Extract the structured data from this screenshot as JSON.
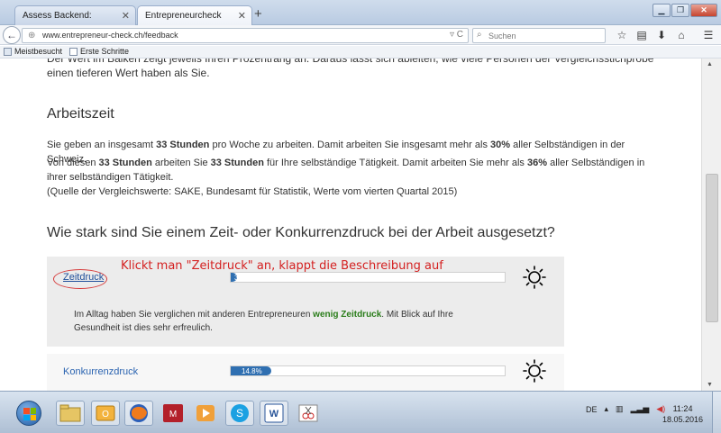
{
  "browser": {
    "tabs": [
      {
        "label": "Assess Backend:",
        "active": false
      },
      {
        "label": "Entrepreneurcheck",
        "active": true
      }
    ],
    "url": "www.entrepreneur-check.ch/feedback",
    "search_placeholder": "Suchen",
    "bookmarks": [
      "Meistbesucht",
      "Erste Schritte"
    ]
  },
  "page": {
    "clipped_text": "Der Wert im Balken zeigt jeweils Ihren Prozentrang an. Daraus lässt sich ableiten, wie viele Personen der Vergleichsstichprobe einen tieferen Wert haben als Sie.",
    "arbeitszeit": {
      "heading": "Arbeitszeit",
      "p1": {
        "a": "Sie geben an insgesamt ",
        "b1": "33 Stunden",
        "c": " pro Woche zu arbeiten. Damit arbeiten Sie insgesamt mehr als ",
        "b2": "30%",
        "d": " aller Selbständigen in der Schweiz."
      },
      "p2": {
        "a": "Von diesen ",
        "b1": "33 Stunden",
        "c": " arbeiten Sie ",
        "b2": "33 Stunden",
        "d": " für Ihre selbständige Tätigkeit. Damit arbeiten Sie mehr als ",
        "b3": "36%",
        "e": " aller Selbständigen in ihrer selbständigen Tätigkeit."
      },
      "source": "(Quelle der Vergleichswerte: SAKE, Bundesamt für Statistik, Werte vom vierten Quartal 2015)"
    },
    "question": "Wie stark sind Sie einem Zeit- oder Konkurrenzdruck bei der Arbeit ausgesetzt?",
    "annotation": "Klickt man \"Zeitdruck\" an, klappt die Beschreibung auf",
    "items": [
      {
        "label": "Zeitdruck",
        "value_label": "3.4",
        "value_fraction": 0.024,
        "description_a": "Im Alltag haben Sie verglichen mit anderen Entrepreneuren ",
        "description_b": "wenig Zeitdruck",
        "description_c": ". Mit Blick auf Ihre Gesundheit ist dies sehr erfreulich."
      },
      {
        "label": "Konkurrenzdruck",
        "value_label": "14.8%",
        "value_fraction": 0.148
      }
    ]
  },
  "taskbar": {
    "tray_lang": "DE",
    "time": "11:24",
    "date": "18.05.2016"
  },
  "colors": {
    "bar_fill": "#2f6fb1",
    "annotation": "#d42020",
    "highlight_green": "#2a7d1a"
  }
}
